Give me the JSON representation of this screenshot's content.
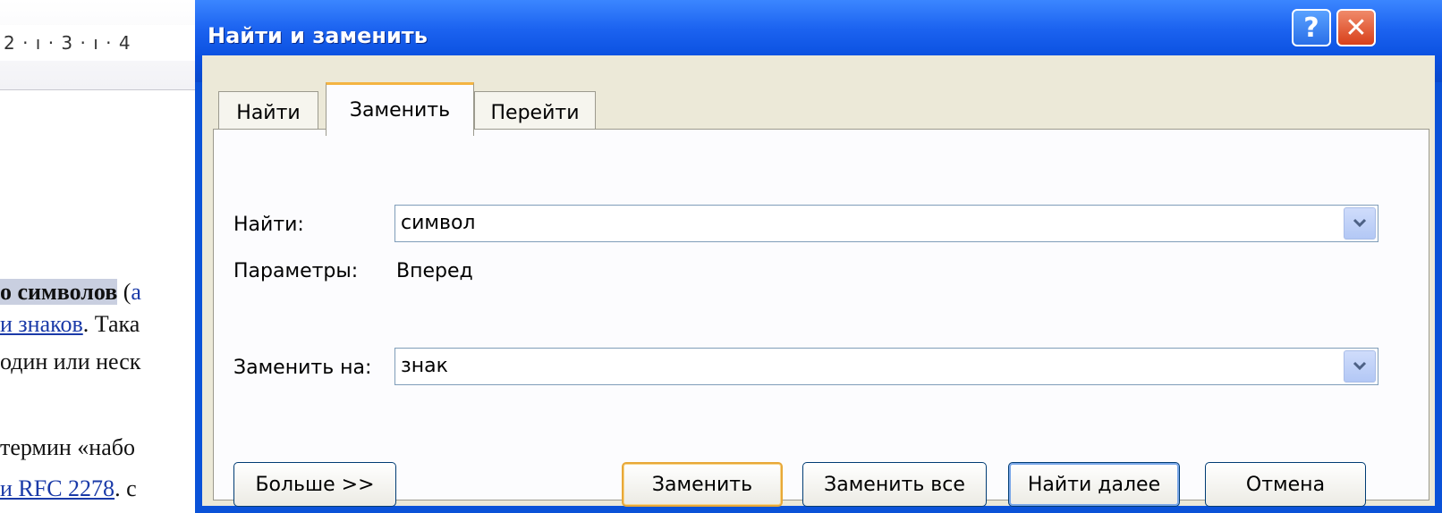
{
  "document": {
    "ruler_text": "2 · ı · 3 · ı · 4",
    "line1_bold": "о символов",
    "line1_tail": " (",
    "line1_link": "а",
    "line2_link": "и знаков",
    "line2_tail": ". Така",
    "line3": "один или неск",
    "line4": "термин «набо",
    "line5_link": "и RFC 2278",
    "line5_tail": ". с"
  },
  "dialog": {
    "title": "Найти и заменить",
    "help_symbol": "?",
    "close_symbol": "✕",
    "tabs": [
      {
        "label": "Найти"
      },
      {
        "label": "Заменить"
      },
      {
        "label": "Перейти"
      }
    ],
    "find_label": "Найти:",
    "find_value": "символ",
    "params_label": "Параметры:",
    "params_value": "Вперед",
    "replace_label": "Заменить на:",
    "replace_value": "знак",
    "buttons": {
      "more": "Больше >>",
      "replace": "Заменить",
      "replace_all": "Заменить все",
      "find_next": "Найти далее",
      "cancel": "Отмена"
    }
  }
}
